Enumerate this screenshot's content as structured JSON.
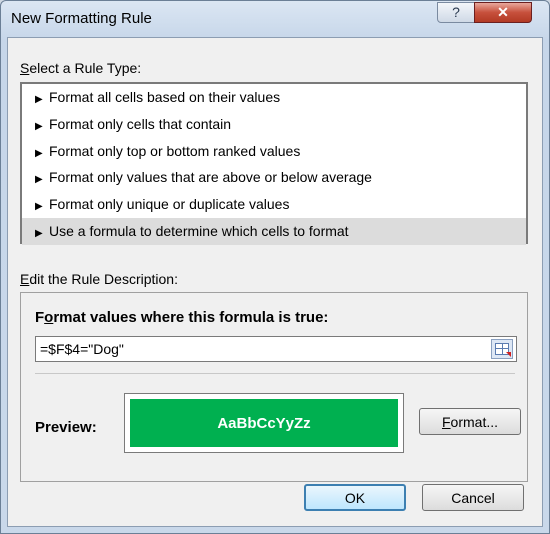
{
  "dialog": {
    "title": "New Formatting Rule",
    "help_glyph": "?",
    "close_glyph": "✕"
  },
  "rule_type": {
    "label_accel": "S",
    "label_rest": "elect a Rule Type:",
    "items": [
      {
        "label": "Format all cells based on their values",
        "selected": false
      },
      {
        "label": "Format only cells that contain",
        "selected": false
      },
      {
        "label": "Format only top or bottom ranked values",
        "selected": false
      },
      {
        "label": "Format only values that are above or below average",
        "selected": false
      },
      {
        "label": "Format only unique or duplicate values",
        "selected": false
      },
      {
        "label": "Use a formula to determine which cells to format",
        "selected": true
      }
    ]
  },
  "description": {
    "label_accel": "E",
    "label_rest": "dit the Rule Description:",
    "formula_title_pre": "F",
    "formula_title_accel": "o",
    "formula_title_rest": "rmat values where this formula is true:",
    "formula_value": "=$F$4=\"Dog\"",
    "preview_label": "Preview:",
    "preview_sample": "AaBbCcYyZz",
    "preview_fill_color": "#00b050",
    "format_button_accel": "F",
    "format_button_rest": "ormat..."
  },
  "footer": {
    "ok_label": "OK",
    "cancel_label": "Cancel"
  }
}
